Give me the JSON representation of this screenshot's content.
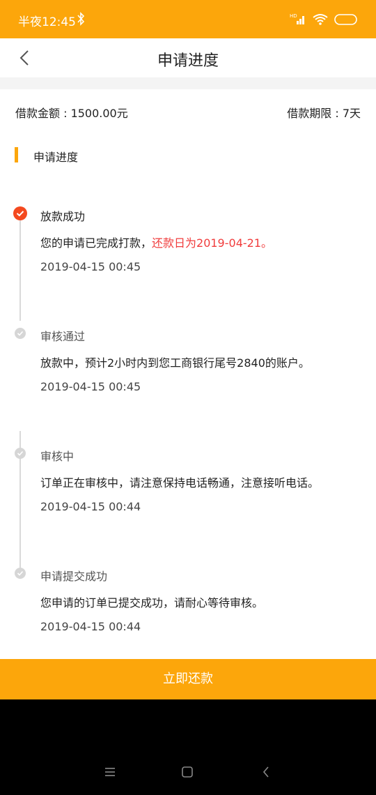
{
  "status_bar": {
    "time": "半夜12:45"
  },
  "nav": {
    "title": "申请进度"
  },
  "summary": {
    "amount": "借款金额 : 1500.00元",
    "term": "借款期限 : 7天"
  },
  "section": {
    "title": "申请进度"
  },
  "steps": [
    {
      "title": "放款成功",
      "desc": "您的申请已完成打款，",
      "desc_highlight": "还款日为2019-04-21。",
      "time": "2019-04-15 00:45",
      "status": "done"
    },
    {
      "title": "审核通过",
      "desc": "放款中，预计2小时内到您工商银行尾号2840的账户。",
      "time": "2019-04-15 00:45",
      "status": "past"
    },
    {
      "title": "审核中",
      "desc": "订单正在审核中，请注意保持电话畅通，注意接听电话。",
      "time": "2019-04-15 00:44",
      "status": "past"
    },
    {
      "title": "申请提交成功",
      "desc": "您申请的订单已提交成功，请耐心等待审核。",
      "time": "2019-04-15 00:44",
      "status": "past"
    }
  ],
  "button": {
    "label": "立即还款"
  },
  "colors": {
    "accent": "#fca60b",
    "active_dot": "#f4491f",
    "highlight": "#f03c3c"
  }
}
